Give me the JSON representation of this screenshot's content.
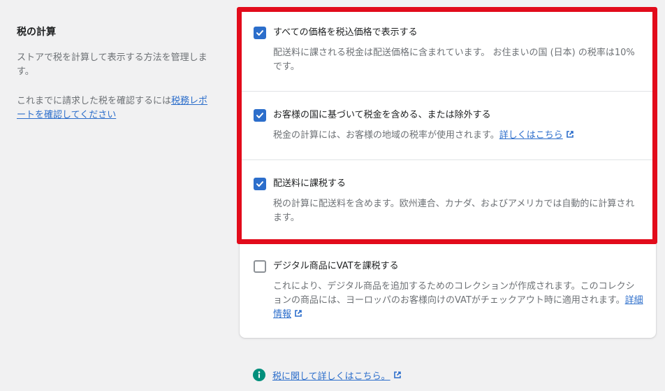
{
  "section": {
    "title": "税の計算",
    "description": "ストアで税を計算して表示する方法を管理します。",
    "report_prefix": "これまでに請求した税を確認するには",
    "report_link": "税務レポートを確認してください"
  },
  "options": [
    {
      "label": "すべての価格を税込価格で表示する",
      "checked": true,
      "description": "配送料に課される税金は配送価格に含まれています。 お住まいの国 (日本) の税率は10%です。"
    },
    {
      "label": "お客様の国に基づいて税金を含める、または除外する",
      "checked": true,
      "description": "税金の計算には、お客様の地域の税率が使用されます。",
      "link": "詳しくはこちら"
    },
    {
      "label": "配送料に課税する",
      "checked": true,
      "description": "税の計算に配送料を含めます。欧州連合、カナダ、およびアメリカでは自動的に計算されます。"
    },
    {
      "label": "デジタル商品にVATを課税する",
      "checked": false,
      "description": "これにより、デジタル商品を追加するためのコレクションが作成されます。このコレクションの商品には、ヨーロッパのお客様向けのVATがチェックアウト時に適用されます。",
      "link": "詳細情報"
    }
  ],
  "footer": {
    "link": "税に関して詳しくはこちら。"
  },
  "colors": {
    "accent": "#2c6ecb",
    "highlight": "#e20b1b",
    "info": "#008f7c"
  }
}
